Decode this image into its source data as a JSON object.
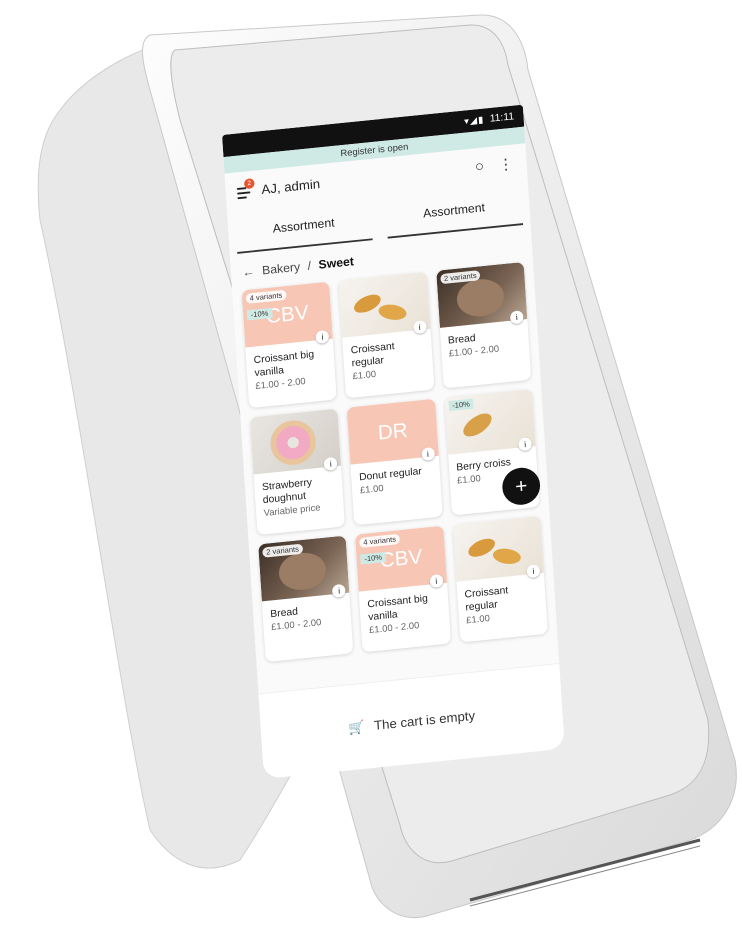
{
  "status": {
    "time": "11:11"
  },
  "banner": {
    "text": "Register is open"
  },
  "topbar": {
    "user": "AJ, admin",
    "badge": "2"
  },
  "tabs": [
    {
      "label": "Assortment"
    },
    {
      "label": "Assortment"
    }
  ],
  "breadcrumb": {
    "parent": "Bakery",
    "separator": "/",
    "current": "Sweet"
  },
  "products": [
    {
      "name": "Croissant big vanilla",
      "price": "£1.00 - 2.00",
      "thumb": "CBV",
      "chip": "4 variants",
      "discount": "-10%"
    },
    {
      "name": "Croissant regular",
      "price": "£1.00"
    },
    {
      "name": "Bread",
      "price": "£1.00 - 2.00",
      "chip": "2 variants"
    },
    {
      "name": "Strawberry doughnut",
      "price": "Variable price"
    },
    {
      "name": "Donut regular",
      "price": "£1.00",
      "thumb": "DR"
    },
    {
      "name": "Berry croiss",
      "price": "£1.00",
      "discount": "-10%"
    },
    {
      "name": "Bread",
      "price": "£1.00 - 2.00",
      "chip": "2 variants"
    },
    {
      "name": "Croissant big vanilla",
      "price": "£1.00 - 2.00",
      "thumb": "CBV",
      "chip": "4 variants",
      "discount": "-10%"
    },
    {
      "name": "Croissant regular",
      "price": "£1.00"
    }
  ],
  "cart": {
    "text": "The cart is empty"
  },
  "colors": {
    "banner": "#cfeae5",
    "accent": "#e8542e",
    "peach": "#f7c6b4"
  }
}
